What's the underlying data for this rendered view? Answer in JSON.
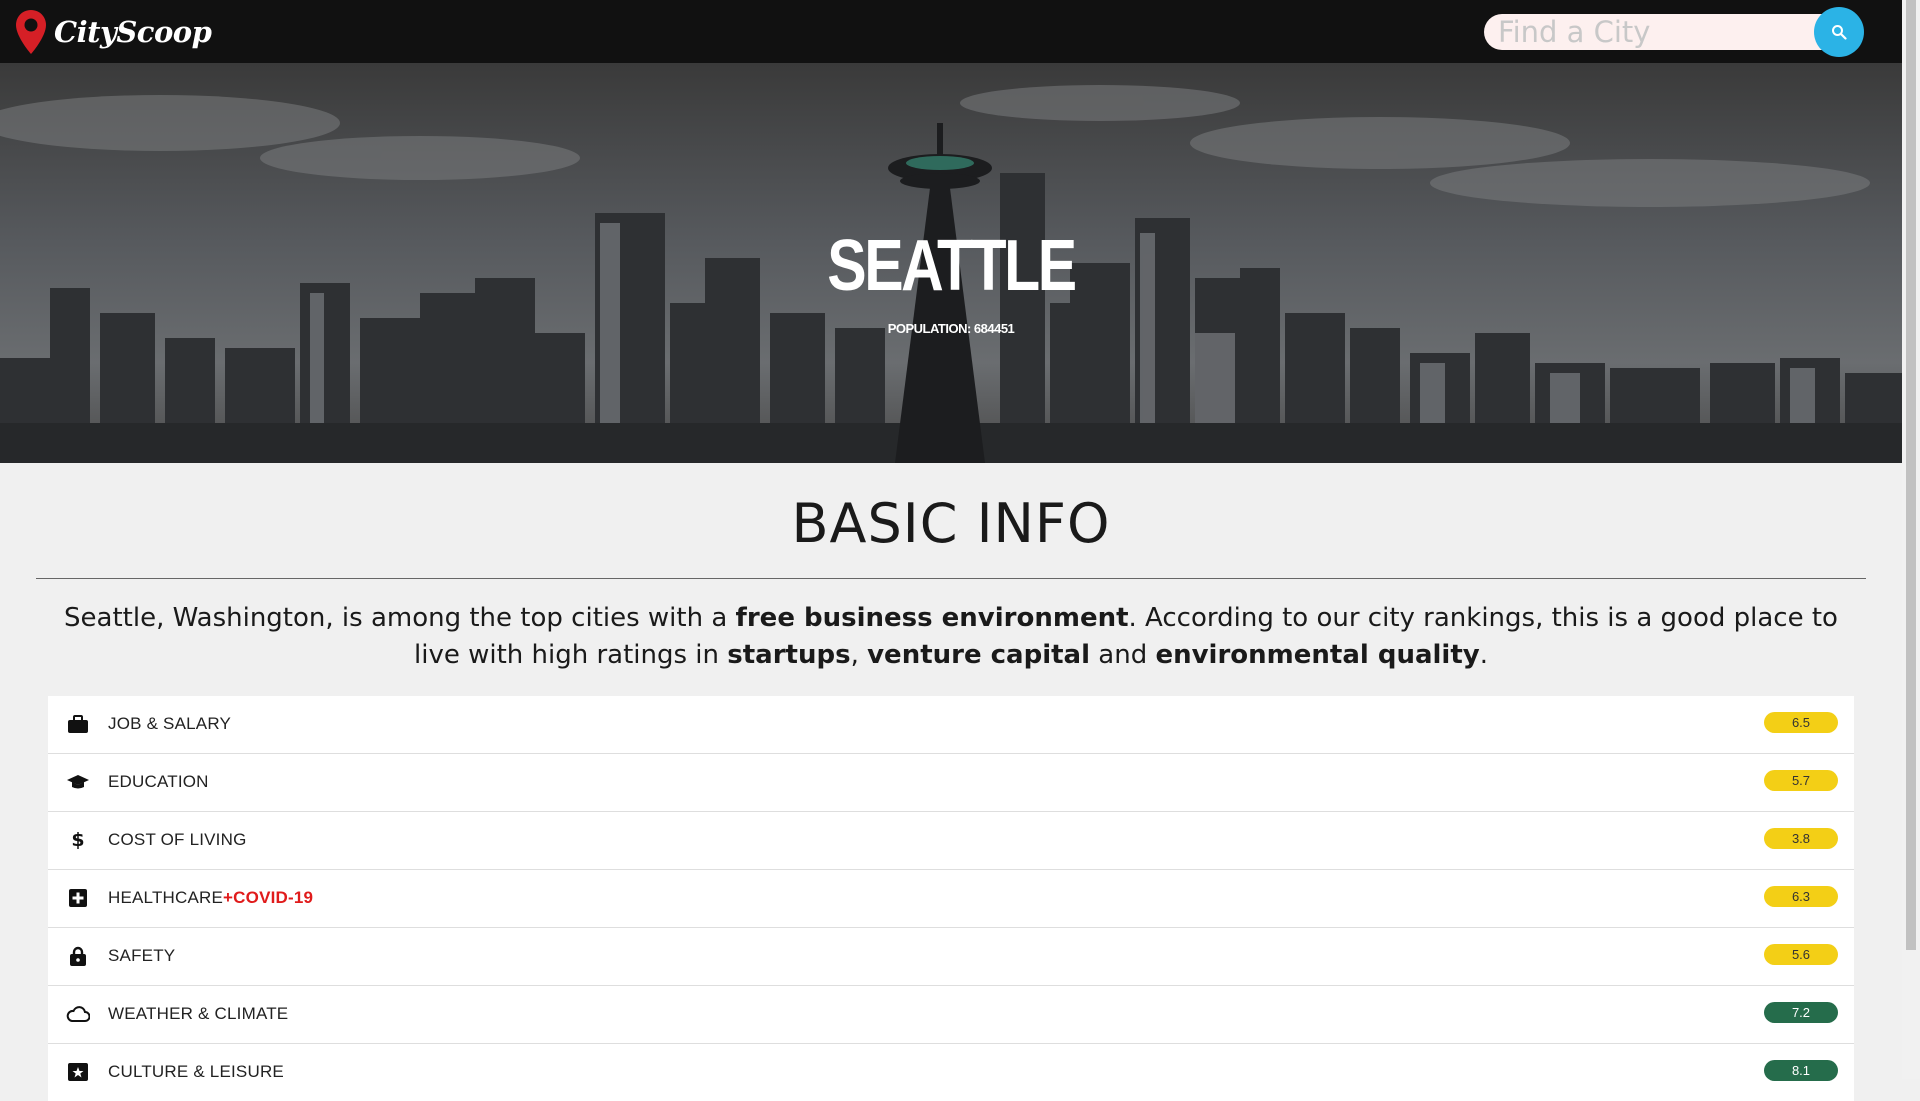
{
  "header": {
    "brand": "CityScoop",
    "search_placeholder": "Find a City",
    "search_value": ""
  },
  "hero": {
    "city": "SEATTLE",
    "population": "POPULATION: 684451"
  },
  "basic_info": {
    "title": "BASIC INFO",
    "summary": {
      "p1": "Seattle, Washington, is among the top cities with a ",
      "b1": "free business environment",
      "p2": ". According to our city rankings, this is a good place to live with high ratings in ",
      "b2": "startups",
      "p3": ", ",
      "b3": "venture capital",
      "p4": " and ",
      "b4": "environmental quality",
      "p5": "."
    }
  },
  "categories": [
    {
      "label": "JOB & SALARY",
      "icon": "briefcase-icon",
      "score": "6.5",
      "level": "yellow"
    },
    {
      "label": "EDUCATION",
      "icon": "graduation-cap-icon",
      "score": "5.7",
      "level": "yellow"
    },
    {
      "label": "COST OF LIVING",
      "icon": "dollar-icon",
      "score": "3.8",
      "level": "yellow"
    },
    {
      "label": "HEALTHCARE",
      "suffix": "+COVID-19",
      "icon": "medical-plus-icon",
      "score": "6.3",
      "level": "yellow"
    },
    {
      "label": "SAFETY",
      "icon": "lock-icon",
      "score": "5.6",
      "level": "yellow"
    },
    {
      "label": "WEATHER & CLIMATE",
      "icon": "cloud-icon",
      "score": "7.2",
      "level": "green"
    },
    {
      "label": "CULTURE & LEISURE",
      "icon": "ticket-icon",
      "score": "8.1",
      "level": "green"
    }
  ],
  "colors": {
    "header_bg": "#111111",
    "search_button": "#2bb3e6",
    "score_yellow": "#f3cf16",
    "score_green": "#256c4b",
    "covid_red": "#e01b1b",
    "logo_pin": "#d61f26"
  }
}
